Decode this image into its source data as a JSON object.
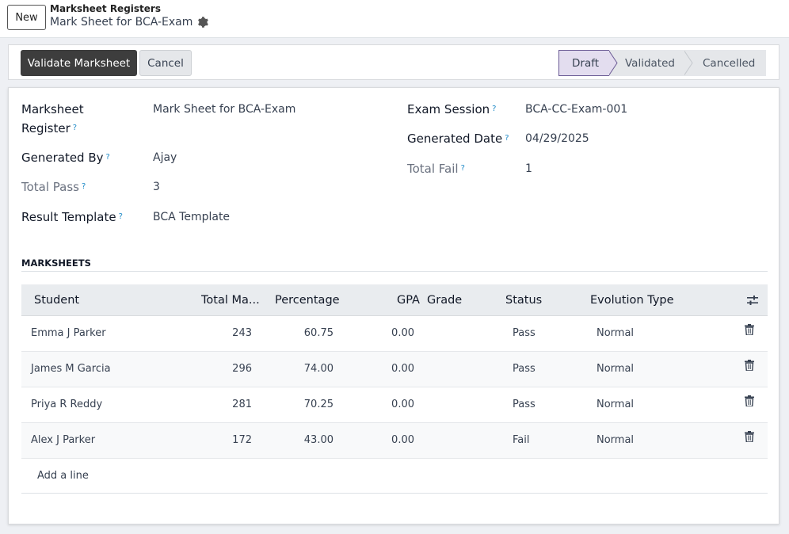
{
  "control_panel": {
    "new_label": "New",
    "breadcrumb_parent": "Marksheet Registers",
    "breadcrumb_current": "Mark Sheet for BCA-Exam",
    "gear_icon": "gear-icon"
  },
  "statusbar": {
    "validate_label": "Validate Marksheet",
    "cancel_label": "Cancel",
    "stages": [
      {
        "label": "Draft",
        "active": true
      },
      {
        "label": "Validated",
        "active": false
      },
      {
        "label": "Cancelled",
        "active": false
      }
    ]
  },
  "form": {
    "register_label_1": "Marksheet",
    "register_label_2": "Register",
    "register_value": "Mark Sheet for BCA-Exam",
    "generated_by_label": "Generated By",
    "generated_by_value": "Ajay",
    "total_pass_label": "Total Pass",
    "total_pass_value": "3",
    "result_template_label": "Result Template",
    "result_template_value": "BCA Template",
    "exam_session_label": "Exam Session",
    "exam_session_value": "BCA-CC-Exam-001",
    "generated_date_label": "Generated Date",
    "generated_date_value": "04/29/2025",
    "total_fail_label": "Total Fail",
    "total_fail_value": "1",
    "help_marker": "?"
  },
  "marksheets": {
    "section_title": "MARKSHEETS",
    "columns": {
      "student": "Student",
      "total": "Total Ma...",
      "percentage": "Percentage",
      "gpa": "GPA",
      "grade": "Grade",
      "status": "Status",
      "evolution": "Evolution Type"
    },
    "rows": [
      {
        "student": "Emma J Parker",
        "total": "243",
        "percentage": "60.75",
        "gpa": "0.00",
        "grade": "",
        "status": "Pass",
        "evolution": "Normal"
      },
      {
        "student": "James M Garcia",
        "total": "296",
        "percentage": "74.00",
        "gpa": "0.00",
        "grade": "",
        "status": "Pass",
        "evolution": "Normal"
      },
      {
        "student": "Priya R Reddy",
        "total": "281",
        "percentage": "70.25",
        "gpa": "0.00",
        "grade": "",
        "status": "Pass",
        "evolution": "Normal"
      },
      {
        "student": "Alex J Parker",
        "total": "172",
        "percentage": "43.00",
        "gpa": "0.00",
        "grade": "",
        "status": "Fail",
        "evolution": "Normal"
      }
    ],
    "add_line_label": "Add a line",
    "column_settings_icon": "sliders-icon",
    "delete_icon": "trash-icon"
  }
}
